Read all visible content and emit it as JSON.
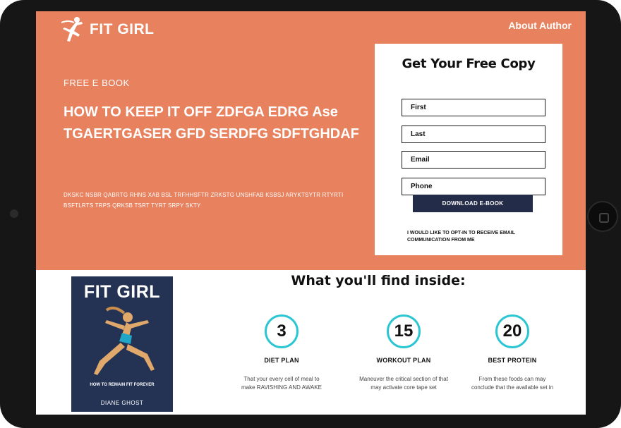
{
  "brand": {
    "name": "FIT GIRL",
    "logo_icon": "running-woman-icon"
  },
  "nav": {
    "about_label": "About Author"
  },
  "hero": {
    "eyebrow": "FREE E BOOK",
    "headline": "HOW TO KEEP IT OFF ZDFGA EDRG Ase TGAERTGASER GFD  SERDFG SDFTGHDAF",
    "blurb": "DKSKC NSBR QABRTG RHNS XAB BSL TRFHHSFTR ZRKSTG UNSHFAB KSBSJ ARYKTSYTR RTYRTI BSFTLRTS TRPS QRKSB TSRT TYRT SRPY SKTY"
  },
  "form": {
    "title": "Get Your Free Copy",
    "fields": [
      {
        "placeholder": "First"
      },
      {
        "placeholder": "Last"
      },
      {
        "placeholder": "Email"
      },
      {
        "placeholder": "Phone"
      }
    ],
    "submit_label": "DOWNLOAD E-BOOK",
    "consent": "I would like to opt-in to receive email communication from me"
  },
  "book": {
    "title": "FIT GIRL",
    "subtitle": "HOW TO REMAIN FIT FOREVER",
    "author": "DIANE GHOST"
  },
  "inside": {
    "title": "What you'll find inside:",
    "accent": "#2bc6d2",
    "items": [
      {
        "number": "3",
        "label": "DIET PLAN",
        "description": "That your every cell of meal to make RAVISHING AND AWAKE"
      },
      {
        "number": "15",
        "label": "WORKOUT PLAN",
        "description": "Maneuver the critical section of that may activate core tape set"
      },
      {
        "number": "20",
        "label": "BEST PROTEIN",
        "description": "From these foods can may conclude that the available set in"
      }
    ]
  },
  "colors": {
    "hero_bg": "#e8815e",
    "book_bg": "#243354",
    "button_bg": "#232c49"
  }
}
